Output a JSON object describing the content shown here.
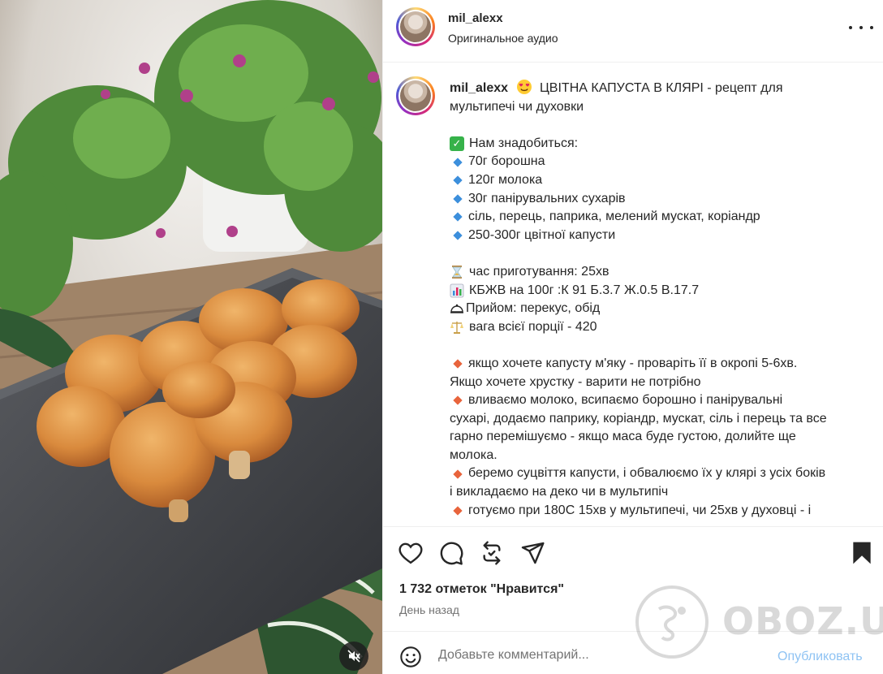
{
  "post": {
    "username": "mil_alexx",
    "audio": "Оригинальное аудио"
  },
  "caption": {
    "username": "mil_alexx",
    "title_line1": "ЦВІТНА КАПУСТА В КЛЯРІ - рецепт для",
    "title_line2": "мультипечі чи духовки",
    "need_header": "Нам знадобиться:",
    "ingredients": [
      "70г борошна",
      "120г молока",
      "30г панірувальних сухарів",
      "сіль, перець, паприка, мелений мускат, коріандр",
      "250-300г цвітної капусти"
    ],
    "time": "час приготування: 25хв",
    "kbzhv": "КБЖВ на 100г :К 91 Б.3.7 Ж.0.5 В.17.7",
    "meal": "Прийом: перекус, обід",
    "weight": "вага всієї порції - 420",
    "steps": [
      [
        "якщо хочете капусту м'яку - проваріть її в окропі 5-6хв.",
        "Якщо хочете хрустку - варити не потрібно"
      ],
      [
        "вливаємо молоко, всипаємо борошно і панірувальні",
        "сухарі, додаємо паприку, коріандр, мускат, сіль і перець та все",
        "гарно перемішуємо - якщо маса буде густою, долийте ще",
        "молока."
      ],
      [
        "беремо суцвіття капусти, і обвалюємо їх у клярі з усіх боків",
        "і викладаємо на деко чи в мультипіч"
      ],
      [
        "готуємо при 180С 15хв у мультипечі, чи 25хв у духовці - і"
      ]
    ]
  },
  "likes": "1 732 отметок \"Нравится\"",
  "date": "День назад",
  "comment": {
    "placeholder": "Добавьте комментарий...",
    "publish_label": "Опубликовать"
  },
  "watermark": "OBOZ.UA",
  "icons": {
    "like": "heart-icon",
    "comment": "comment-icon",
    "repost": "repost-icon",
    "share": "send-icon",
    "save": "bookmark-icon",
    "more": "more-icon",
    "mute": "speaker-muted-icon",
    "emoji": "emoji-icon"
  },
  "colors": {
    "publish": "#8fc3f3",
    "text": "#262626",
    "secondary": "#737373",
    "bullet_blue": "#3c8fdc",
    "bullet_orange": "#e8643c"
  }
}
